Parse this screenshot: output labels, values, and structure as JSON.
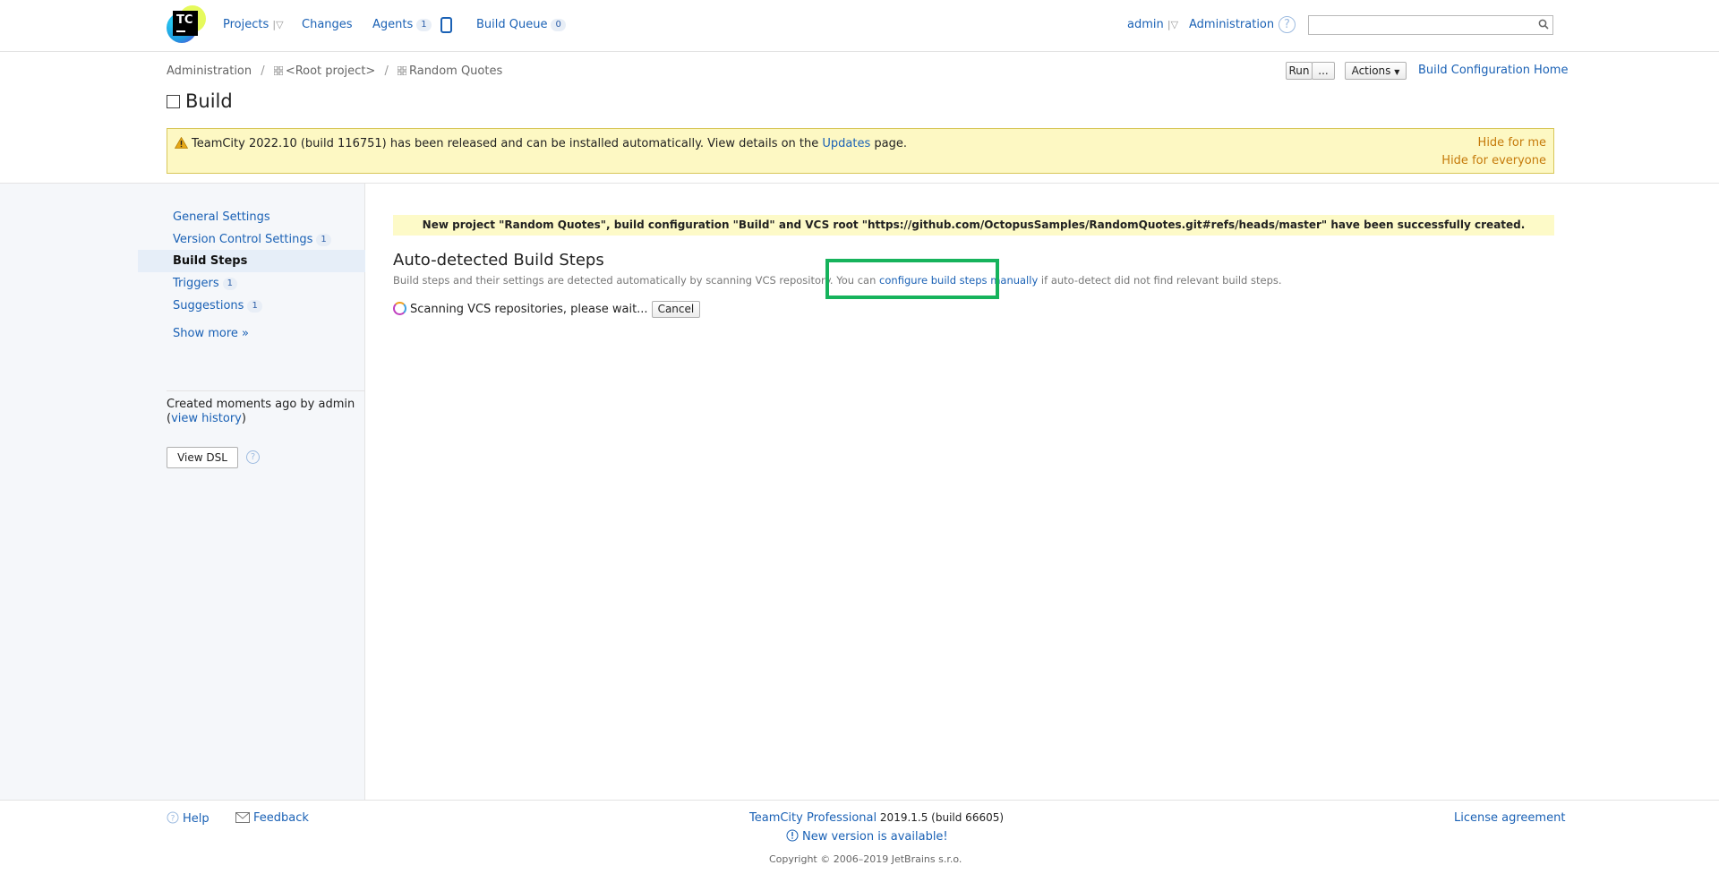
{
  "header": {
    "nav": {
      "projects": "Projects",
      "changes": "Changes",
      "agents": "Agents",
      "agents_count": "1",
      "build_queue": "Build Queue",
      "build_queue_count": "0"
    },
    "user": "admin",
    "administration": "Administration",
    "search_placeholder": ""
  },
  "breadcrumb": {
    "items": [
      "Administration",
      "<Root project>",
      "Random Quotes"
    ]
  },
  "toolbar": {
    "run": "Run",
    "more": "...",
    "actions": "Actions",
    "home_link": "Build Configuration Home"
  },
  "page": {
    "title": "Build"
  },
  "update_banner": {
    "text_before": "TeamCity 2022.10 (build 116751) has been released and can be installed automatically. View details on the ",
    "link": "Updates",
    "text_after": " page.",
    "hide_for_me": "Hide for me",
    "hide_for_everyone": "Hide for everyone"
  },
  "sidebar": {
    "items": [
      {
        "label": "General Settings",
        "badge": ""
      },
      {
        "label": "Version Control Settings",
        "badge": "1"
      },
      {
        "label": "Build Steps",
        "badge": ""
      },
      {
        "label": "Triggers",
        "badge": "1"
      },
      {
        "label": "Suggestions",
        "badge": "1"
      }
    ],
    "show_more": "Show more »",
    "created_text": "Created moments ago by admin",
    "view_history_open": "(",
    "view_history": "view history",
    "view_history_close": ")",
    "view_dsl": "View DSL"
  },
  "main": {
    "success_message": "New project \"Random Quotes\", build configuration \"Build\" and VCS root \"https://github.com/OctopusSamples/RandomQuotes.git#refs/heads/master\" have been successfully created.",
    "section_title": "Auto-detected Build Steps",
    "desc_before": "Build steps and their settings are detected automatically by scanning VCS repository. You can ",
    "desc_link": "configure build steps manually",
    "desc_after": " if auto-detect did not find relevant build steps.",
    "scanning": "Scanning VCS repositories, please wait...",
    "cancel": "Cancel"
  },
  "footer": {
    "help": "Help",
    "feedback": "Feedback",
    "product_link": "TeamCity Professional",
    "product_version": " 2019.1.5 (build 66605)",
    "new_version": "New version is available!",
    "copyright": "Copyright © 2006–2019 JetBrains s.r.o.",
    "license": "License agreement"
  },
  "colors": {
    "link": "#1a61b5",
    "highlight": "#16b35c",
    "warning_bg": "#fdf8c3",
    "warning_link": "#c57a0a"
  }
}
